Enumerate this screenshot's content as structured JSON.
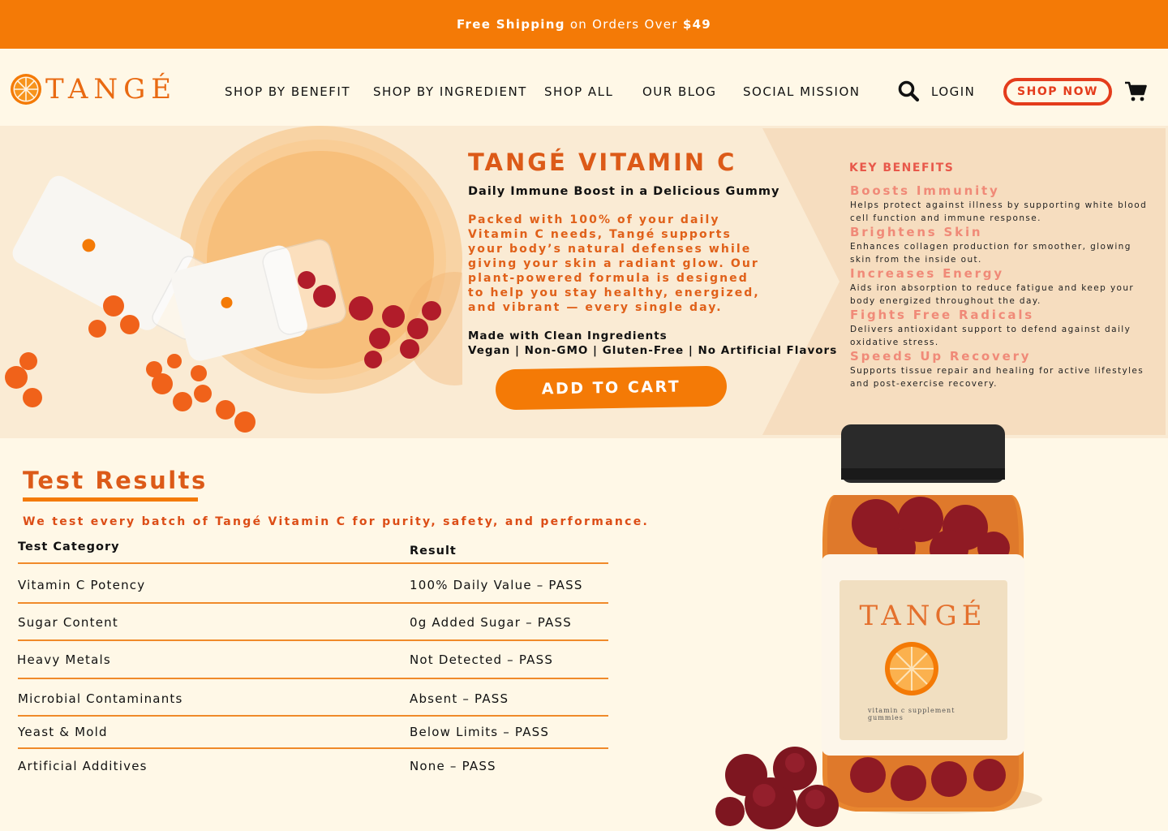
{
  "promo": {
    "free_shipping": "Free Shipping",
    "middle": " on Orders Over ",
    "amount": "$49"
  },
  "brand": {
    "name": "TANGÉ"
  },
  "nav": {
    "items": [
      {
        "label": "SHOP BY BENEFIT"
      },
      {
        "label": "SHOP BY INGREDIENT"
      },
      {
        "label": "SHOP ALL"
      },
      {
        "label": "OUR BLOG"
      },
      {
        "label": "SOCIAL MISSION"
      }
    ],
    "login": "LOGIN",
    "shop_now": "SHOP NOW"
  },
  "hero": {
    "title": "TANGÉ VITAMIN C",
    "subtitle": "Daily Immune Boost in a Delicious Gummy",
    "description": "Packed with 100% of your daily Vitamin C needs, Tangé supports your body’s natural defenses while giving your skin a radiant glow. Our plant-powered formula is designed to help you stay healthy, energized, and vibrant — every single day.",
    "clean_line1": "Made with Clean Ingredients",
    "clean_line2": "Vegan | Non-GMO | Gluten-Free | No Artificial Flavors",
    "add_to_cart": "ADD TO CART"
  },
  "key_benefits": {
    "heading": "KEY BENEFITS",
    "items": [
      {
        "title": "Boosts Immunity",
        "text": "Helps protect against illness by supporting white blood cell function and immune response."
      },
      {
        "title": "Brightens Skin",
        "text": "Enhances collagen production for smoother, glowing skin from the inside out."
      },
      {
        "title": "Increases Energy",
        "text": "Aids iron absorption to reduce fatigue and keep your body energized throughout the day."
      },
      {
        "title": "Fights Free Radicals",
        "text": "Delivers antioxidant support to defend against daily oxidative stress."
      },
      {
        "title": "Speeds Up Recovery",
        "text": "Supports tissue repair and healing for active lifestyles and post-exercise recovery."
      }
    ]
  },
  "test_results": {
    "title": "Test Results",
    "intro": "We test every batch of Tangé Vitamin C for purity, safety, and performance.",
    "headers": {
      "category": "Test Category",
      "result": "Result"
    },
    "rows": [
      {
        "category": "Vitamin C Potency",
        "result": "100% Daily Value – PASS"
      },
      {
        "category": "Sugar Content",
        "result": "0g Added Sugar – PASS"
      },
      {
        "category": "Heavy Metals",
        "result": "Not Detected – PASS"
      },
      {
        "category": "Microbial Contaminants",
        "result": "Absent – PASS"
      },
      {
        "category": "Yeast & Mold",
        "result": "Below Limits – PASS"
      },
      {
        "category": "Artificial Additives",
        "result": "None – PASS"
      }
    ]
  },
  "jar_label": {
    "brand": "TANGÉ",
    "line1": "vitamin c supplement",
    "line2": "gummies"
  },
  "colors": {
    "accent": "#f47a06",
    "title_orange": "#dc5a18",
    "shop_now_red": "#e43c1c",
    "benefit_pink": "#f08a78",
    "background": "#fff8e7",
    "hero_background": "#faebd4"
  }
}
